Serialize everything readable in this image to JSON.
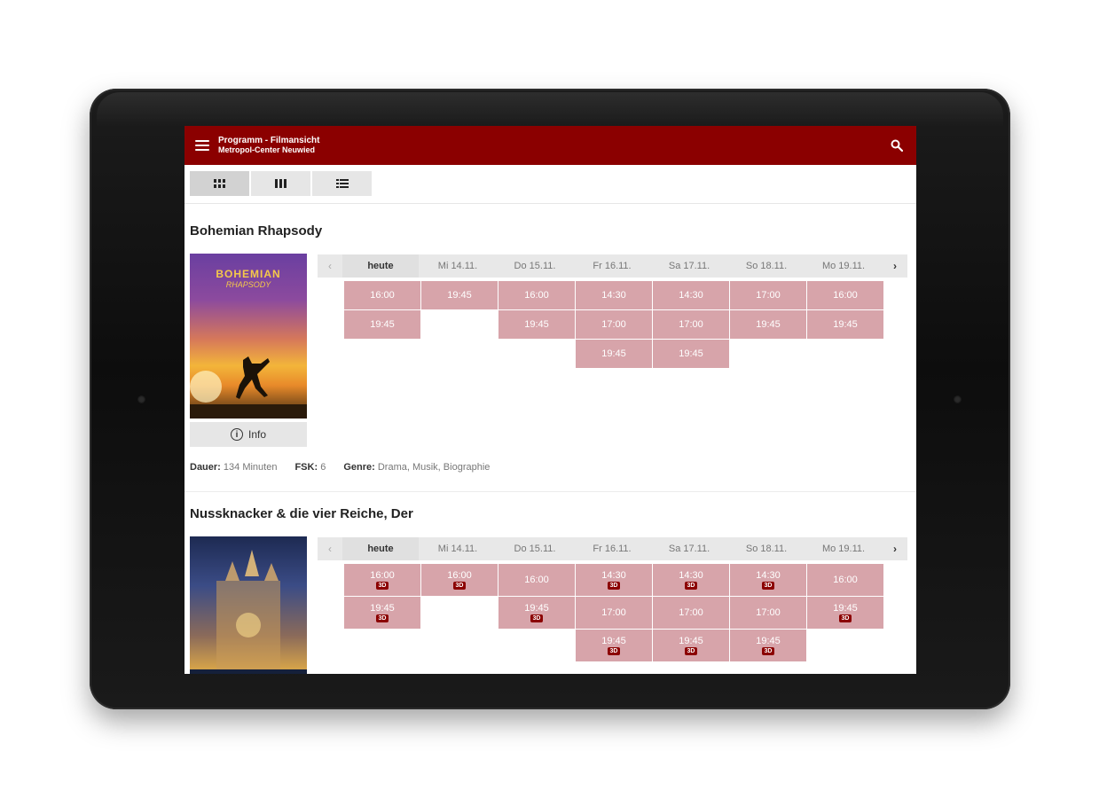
{
  "app": {
    "title": "Programm - Filmansicht",
    "subtitle": "Metropol-Center Neuwied"
  },
  "icons": {
    "menu": "menu-icon",
    "search": "search-icon",
    "view_grid": "grid-icon",
    "view_columns": "columns-icon",
    "view_list": "list-icon",
    "info": "info-icon"
  },
  "colors": {
    "appbar": "#8b0000",
    "slot": "#d7a4aa",
    "badge": "#8b0000"
  },
  "movies": [
    {
      "title": "Bohemian Rhapsody",
      "poster_title": "BOHEMIAN",
      "poster_subtitle": "RHAPSODY",
      "info_label": "Info",
      "meta": [
        {
          "label": "Dauer:",
          "value": "134 Minuten"
        },
        {
          "label": "FSK:",
          "value": "6"
        },
        {
          "label": "Genre:",
          "value": "Drama, Musik, Biographie"
        }
      ],
      "days": [
        "heute",
        "Mi 14.11.",
        "Do 15.11.",
        "Fr 16.11.",
        "Sa 17.11.",
        "So 18.11.",
        "Mo 19.11."
      ],
      "showtimes": [
        [
          {
            "time": "16:00"
          },
          {
            "time": "19:45"
          }
        ],
        [
          {
            "time": "19:45"
          }
        ],
        [
          {
            "time": "16:00"
          },
          {
            "time": "19:45"
          }
        ],
        [
          {
            "time": "14:30"
          },
          {
            "time": "17:00"
          },
          {
            "time": "19:45"
          }
        ],
        [
          {
            "time": "14:30"
          },
          {
            "time": "17:00"
          },
          {
            "time": "19:45"
          }
        ],
        [
          {
            "time": "17:00"
          },
          {
            "time": "19:45"
          }
        ],
        [
          {
            "time": "16:00"
          },
          {
            "time": "19:45"
          }
        ]
      ]
    },
    {
      "title": "Nussknacker & die vier Reiche, Der",
      "days": [
        "heute",
        "Mi 14.11.",
        "Do 15.11.",
        "Fr 16.11.",
        "Sa 17.11.",
        "So 18.11.",
        "Mo 19.11."
      ],
      "showtimes": [
        [
          {
            "time": "16:00",
            "badge": "3D"
          },
          {
            "time": "19:45",
            "badge": "3D"
          }
        ],
        [
          {
            "time": "16:00",
            "badge": "3D"
          }
        ],
        [
          {
            "time": "16:00"
          },
          {
            "time": "19:45",
            "badge": "3D"
          }
        ],
        [
          {
            "time": "14:30",
            "badge": "3D"
          },
          {
            "time": "17:00"
          },
          {
            "time": "19:45",
            "badge": "3D"
          }
        ],
        [
          {
            "time": "14:30",
            "badge": "3D"
          },
          {
            "time": "17:00"
          },
          {
            "time": "19:45",
            "badge": "3D"
          }
        ],
        [
          {
            "time": "14:30",
            "badge": "3D"
          },
          {
            "time": "17:00"
          },
          {
            "time": "19:45",
            "badge": "3D"
          }
        ],
        [
          {
            "time": "16:00"
          },
          {
            "time": "19:45",
            "badge": "3D"
          }
        ]
      ]
    }
  ]
}
